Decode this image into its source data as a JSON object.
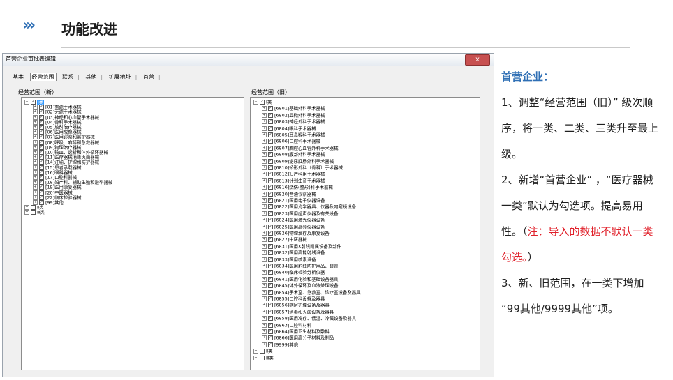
{
  "slide": {
    "title": "功能改进",
    "arrows": "›››"
  },
  "dialog": {
    "title": "首营企业审批表编辑",
    "close_label": "x",
    "tabs": [
      "基本",
      "经营范围",
      "联系",
      "其他",
      "扩展地址",
      "首营"
    ],
    "active_tab": "经营范围",
    "new_label": "经营范围（新）",
    "old_label": "经营范围（旧）",
    "new_tree": {
      "root_symbol": "⊟",
      "root_label": "Ⅰ类",
      "items": [
        "[01]有源手术器械",
        "[02]无源手术器械",
        "[03]神经和心血管手术器械",
        "[04]骨科手术器械",
        "[05]放射治疗器械",
        "[06]医用成像器械",
        "[07]医用诊察和监护器械",
        "[08]呼吸、麻醉和急救器械",
        "[09]物理治疗器械",
        "[10]输血、透析和体外循环器械",
        "[11]医疗器械消毒灭菌器械",
        "[14]注输、护理和防护器械",
        "[15]患者承载器械",
        "[16]眼科器械",
        "[17]口腔科器械",
        "[18]妇产科、辅助生殖和避孕器械",
        "[19]医用康复器械",
        "[20]中医器械",
        "[22]临床检验器械",
        "[99]其他"
      ],
      "other_roots": [
        "Ⅱ类",
        "Ⅲ类"
      ]
    },
    "old_tree": {
      "root_label": "Ⅰ类",
      "items": [
        "[6801]基础外科手术器械",
        "[6802]显微外科手术器械",
        "[6803]神经外科手术器械",
        "[6804]眼科手术器械",
        "[6805]耳鼻喉科手术器械",
        "[6806]口腔科手术器械",
        "[6807]胸腔心血管外科手术器械",
        "[6808]腹部外科手术器械",
        "[6809]泌尿肛肠外科手术器械",
        "[6810]矫形外科（骨科）手术器械",
        "[6812]妇产科用手术器械",
        "[6813]计划生育手术器械",
        "[6816]烧伤(整形)科手术器械",
        "[6820]普通诊察器械",
        "[6821]医用电子仪器设备",
        "[6822]医用光学器具、仪器及内窥镜设备",
        "[6823]医用超声仪器及有关设备",
        "[6824]医用激光仪器设备",
        "[6825]医用高频仪器设备",
        "[6826]物理治疗及康复设备",
        "[6827]中医器械",
        "[6831]医用X射线附属设备及部件",
        "[6832]医用高能射线设备",
        "[6833]医用核素设备",
        "[6834]医用射线防护用品、装置",
        "[6840]临床检验分析仪器",
        "[6841]医用化验和基础设备器具",
        "[6845]体外循环及血液处理设备",
        "[6854]手术室、急救室、诊疗室设备及器具",
        "[6855]口腔科设备及器具",
        "[6856]病房护理设备及器具",
        "[6857]消毒和灭菌设备及器具",
        "[6858]医用冷疗、低温、冷藏设备及器具",
        "[6863]口腔科材料",
        "[6864]医用卫生材料及敷料",
        "[6866]医用高分子材料及制品",
        "[9999]其他"
      ],
      "other_roots": [
        "Ⅱ类",
        "Ⅲ类"
      ]
    }
  },
  "notes": {
    "heading": "首营企业：",
    "p1": "1、调整“经营范围（旧）” 级次顺序，将一类、二类、三类升至最上级。",
    "p2a": "2、新增“首营企业” ，“医疗器械一类”默认为勾选项。提高易用性。（",
    "p2b": "注：导入的数据不默认一类勾选。",
    "p2c": "）",
    "p3": "3、新、旧范围，在一类下增加 “99其他/9999其他”项。"
  },
  "colors": {
    "accent": "#2f6fb5",
    "warn": "#e0202a",
    "selection": "#3399ff"
  }
}
